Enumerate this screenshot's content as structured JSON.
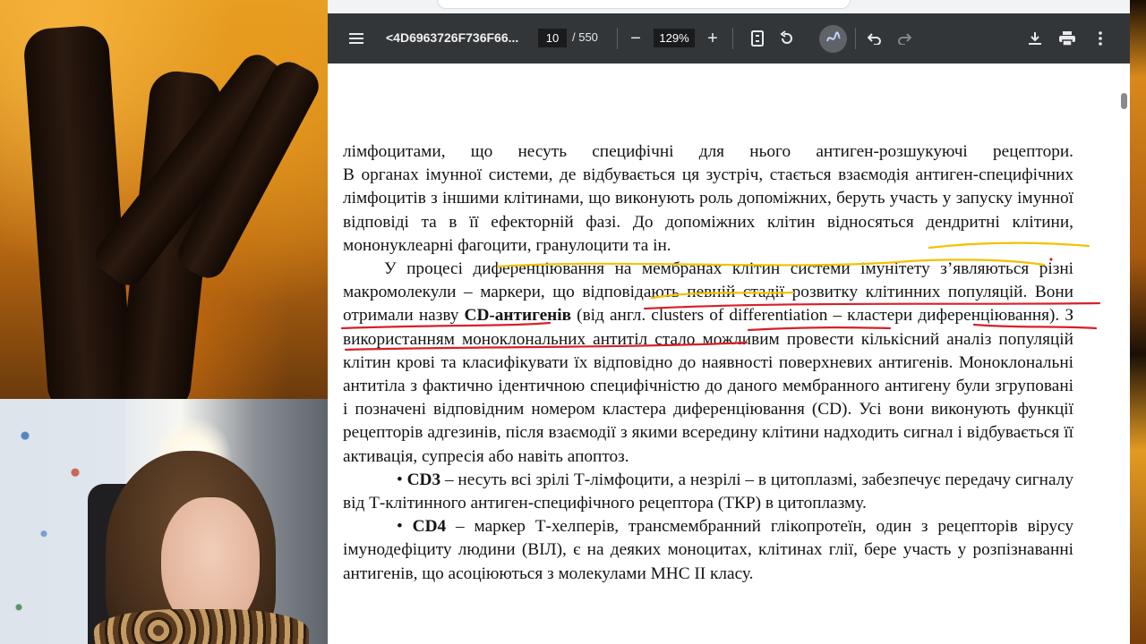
{
  "pdf_viewer": {
    "document_title": "<4D6963726F736F66...",
    "current_page": "10",
    "total_pages": "/ 550",
    "zoom_level": "129%",
    "icons": [
      "menu-icon",
      "zoom-out-icon",
      "zoom-in-icon",
      "fit-page-icon",
      "rotate-icon",
      "annotate-icon",
      "undo-icon",
      "redo-icon",
      "download-icon",
      "print-icon",
      "more-options-icon"
    ],
    "zoom_out_glyph": "−",
    "zoom_in_glyph": "+"
  },
  "document": {
    "para1_line1": "лімфоцитами, що несуть специфічні для нього антиген-розшукуючі рецептори.",
    "para1_rest": "В органах імунної системи, де відбувається ця зустріч, стається взаємодія антиген-специфічних лімфоцитів з іншими клітинами, що виконують роль допоміжних, беруть участь у запуску імунної відповіді та в її ефекторній фазі. До допоміжних клітин відносяться дендритні клітини, мононуклеарні фагоцити, гранулоцити та ін.",
    "para2_a": "У процесі диференціювання на мембранах клітин системи імунітету з’являються різні макромолекули – маркери, що відповідають певній стадії розвитку клітинних популяцій. Вони отримали назву ",
    "para2_bold": "CD-антигенів",
    "para2_b": " (від англ. clusters of differentiation – кластери диференціювання). З використанням моноклональних антитіл стало можливим провести кількісний аналіз популяцій клітин крові та класифікувати їх відповідно до наявності поверхневих антигенів. Моноклональні антитіла з фактично ідентичною специфічністю до даного мембранного антигену були згруповані і позначені відповідним номером кластера диференціювання (CD). Усі вони виконують функції рецепторів адгезинів, після взаємодії з якими всередину клітини надходить сигнал і відбувається її активація, супресія або навіть апоптоз.",
    "bullet_symbol": "•",
    "cd3_label": "CD3",
    "cd3_text": " – несуть всі зрілі Т-лімфоцити, а незрілі – в цитоплазмі, забезпечує передачу сигналу від Т-клітинного антиген-специфічного рецептора (ТКР) в цитоплазму.",
    "cd4_label": "CD4",
    "cd4_text": " – маркер Т-хелперів, трансмембранний глікопротеїн, один з рецепторів вірусу імунодефіциту людини (ВІЛ), є на деяких моноцитах, клітинах глії,  бере участь у розпізнаванні антигенів, що асоціюються з молекулами МНС ІІ класу."
  },
  "colors": {
    "toolbar_bg": "#323639",
    "highlight_yellow": "#f2c200",
    "highlight_red": "#d8202a"
  }
}
